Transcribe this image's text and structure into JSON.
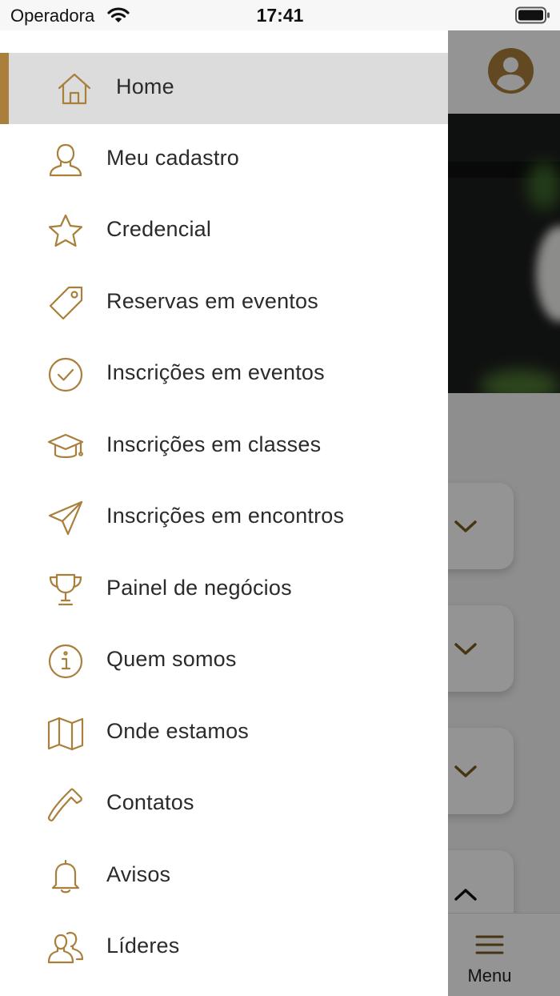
{
  "status_bar": {
    "carrier": "Operadora",
    "time": "17:41"
  },
  "colors": {
    "accent": "#a97f3b",
    "active_item_bg": "#dcdcdc",
    "text": "#2b2b2b"
  },
  "drawer": {
    "items": [
      {
        "label": "Home",
        "icon": "home-icon",
        "active": true
      },
      {
        "label": "Meu cadastro",
        "icon": "user-icon"
      },
      {
        "label": "Credencial",
        "icon": "star-icon"
      },
      {
        "label": "Reservas em eventos",
        "icon": "tag-icon"
      },
      {
        "label": "Inscrições em eventos",
        "icon": "check-circle-icon"
      },
      {
        "label": "Inscrições em classes",
        "icon": "graduation-cap-icon"
      },
      {
        "label": "Inscrições em encontros",
        "icon": "paper-plane-icon"
      },
      {
        "label": "Painel de negócios",
        "icon": "trophy-icon"
      },
      {
        "label": "Quem somos",
        "icon": "info-icon"
      },
      {
        "label": "Onde estamos",
        "icon": "map-icon"
      },
      {
        "label": "Contatos",
        "icon": "phone-icon"
      },
      {
        "label": "Avisos",
        "icon": "bell-icon"
      },
      {
        "label": "Líderes",
        "icon": "users-icon"
      }
    ]
  },
  "tabbar": {
    "menu_label": "Menu"
  }
}
